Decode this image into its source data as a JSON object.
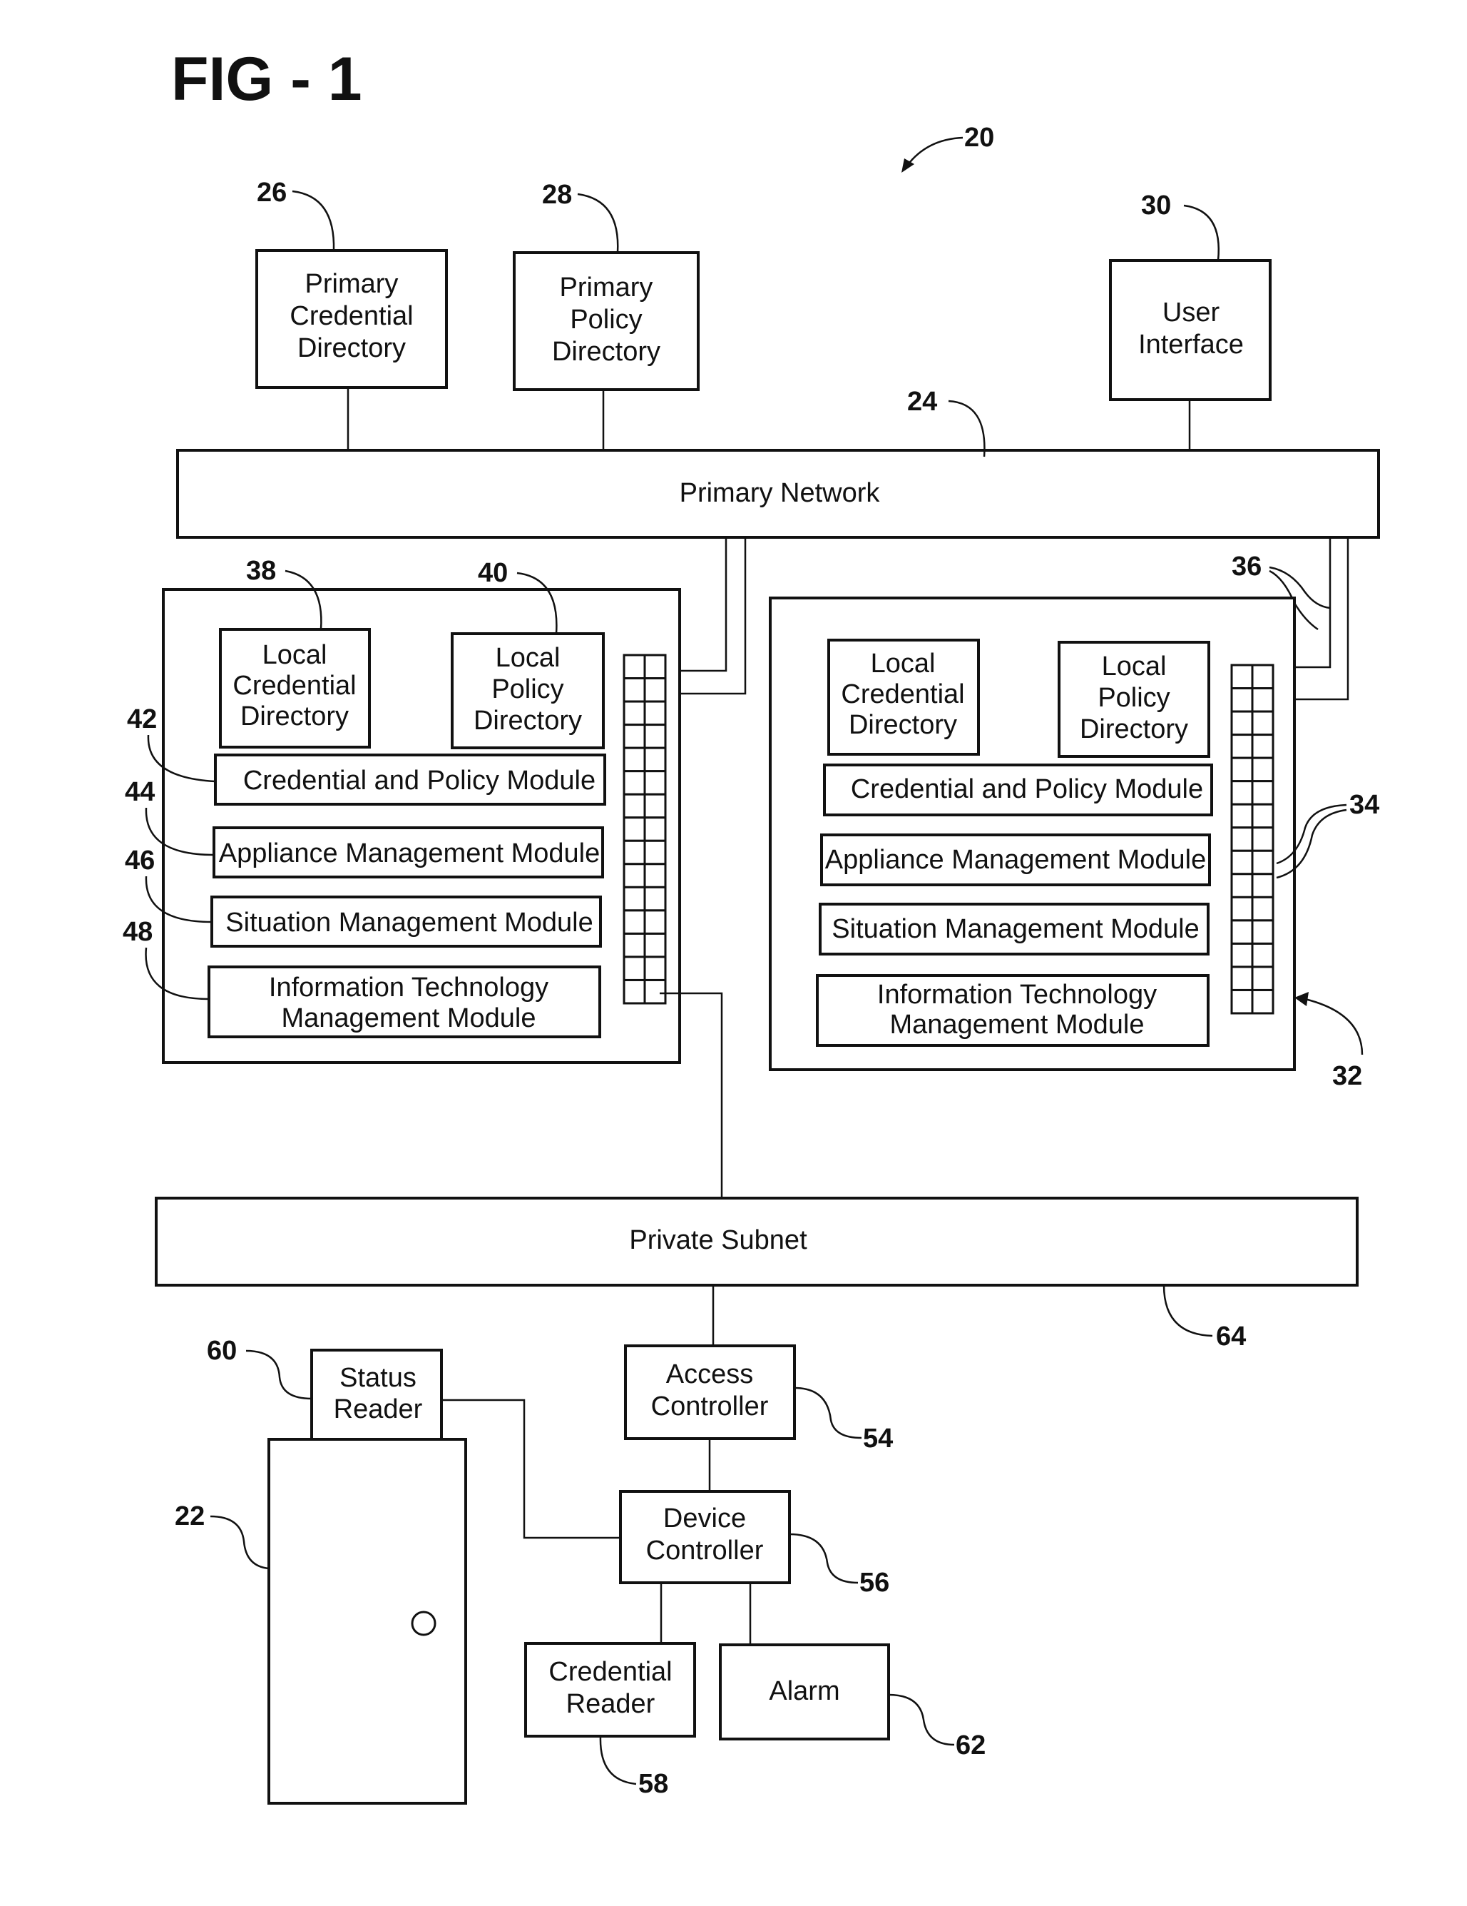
{
  "figure": {
    "title": "FIG - 1",
    "system_ref": "20"
  },
  "top_components": [
    {
      "id": "primary-credential-directory",
      "ref": "26",
      "lines": [
        "Primary",
        "Credential",
        "Directory"
      ]
    },
    {
      "id": "primary-policy-directory",
      "ref": "28",
      "lines": [
        "Primary",
        "Policy",
        "Directory"
      ]
    },
    {
      "id": "user-interface",
      "ref": "30",
      "lines": [
        "User",
        "Interface"
      ]
    }
  ],
  "primary_network": {
    "label": "Primary Network",
    "ref": "24"
  },
  "appliances": [
    {
      "ref": null,
      "local_credential_directory": {
        "ref": "38",
        "lines": [
          "Local",
          "Credential",
          "Directory"
        ]
      },
      "local_policy_directory": {
        "ref": "40",
        "lines": [
          "Local",
          "Policy",
          "Directory"
        ]
      },
      "modules": [
        {
          "ref": "42",
          "lines": [
            "Credential and Policy Module"
          ]
        },
        {
          "ref": "44",
          "lines": [
            "Appliance Management Module"
          ]
        },
        {
          "ref": "46",
          "lines": [
            "Situation Management Module"
          ]
        },
        {
          "ref": "48",
          "lines": [
            "Information Technology",
            "Management Module"
          ]
        }
      ],
      "port_grid": {
        "rows": 15,
        "cols": 2
      }
    },
    {
      "ref": "32",
      "local_credential_directory": {
        "ref": null,
        "lines": [
          "Local",
          "Credential",
          "Directory"
        ]
      },
      "local_policy_directory": {
        "ref": null,
        "lines": [
          "Local",
          "Policy",
          "Directory"
        ]
      },
      "modules": [
        {
          "ref": null,
          "lines": [
            "Credential and Policy Module"
          ]
        },
        {
          "ref": null,
          "lines": [
            "Appliance Management Module"
          ]
        },
        {
          "ref": null,
          "lines": [
            "Situation Management Module"
          ]
        },
        {
          "ref": null,
          "lines": [
            "Information Technology",
            "Management Module"
          ]
        }
      ],
      "port_grid": {
        "rows": 15,
        "cols": 2
      },
      "ports_ref": "34",
      "uplinks_ref": "36"
    }
  ],
  "private_subnet": {
    "label": "Private Subnet",
    "ref": "64"
  },
  "bottom_components": [
    {
      "id": "status-reader",
      "ref": "60",
      "lines": [
        "Status",
        "Reader"
      ]
    },
    {
      "id": "door",
      "ref": "22",
      "lines": []
    },
    {
      "id": "access-controller",
      "ref": "54",
      "lines": [
        "Access",
        "Controller"
      ]
    },
    {
      "id": "device-controller",
      "ref": "56",
      "lines": [
        "Device",
        "Controller"
      ]
    },
    {
      "id": "credential-reader",
      "ref": "58",
      "lines": [
        "Credential",
        "Reader"
      ]
    },
    {
      "id": "alarm",
      "ref": "62",
      "lines": [
        "Alarm"
      ]
    }
  ]
}
